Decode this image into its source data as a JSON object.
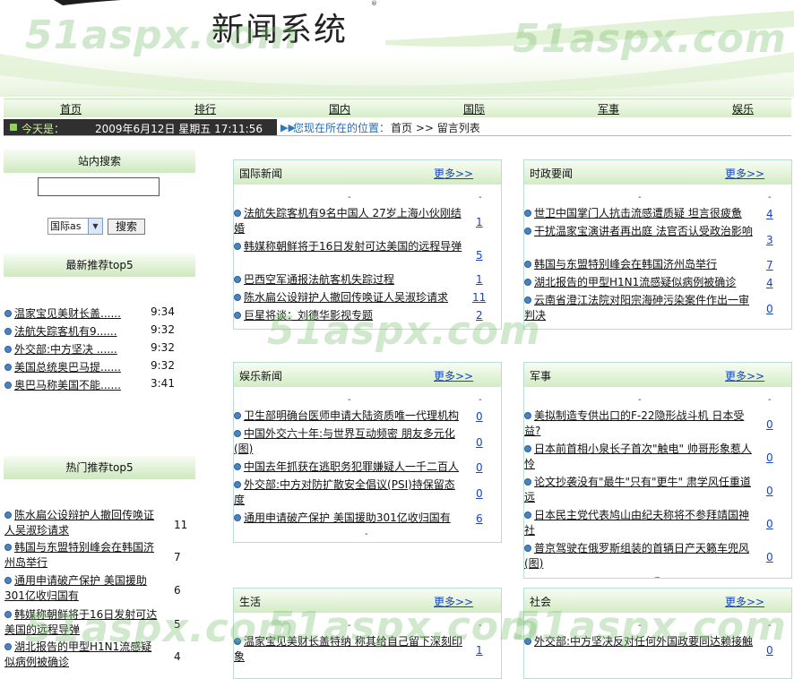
{
  "site": {
    "title": "新闻系统",
    "registered_mark": "®",
    "watermark": "51aspx.com"
  },
  "nav": {
    "items": [
      "首页",
      "排行",
      "国内",
      "国际",
      "军事",
      "娱乐"
    ]
  },
  "datebar": {
    "today_label": "今天是：",
    "date": "2009年6月12日 星期五 17:11:56",
    "location_label": "您现在所在的位置：",
    "location_path": "首页 >> 留言列表"
  },
  "search": {
    "title": "站内搜索",
    "input_value": "",
    "select_value": "国际as",
    "button_label": "搜索"
  },
  "recommend": {
    "title": "最新推荐top5",
    "items": [
      {
        "title": "温家宝见美财长盖......",
        "time": "9:34"
      },
      {
        "title": "法航失踪客机有9......",
        "time": "9:32"
      },
      {
        "title": "外交部:中方坚决 ......",
        "time": "9:32"
      },
      {
        "title": "美国总统奥巴马提......",
        "time": "9:32"
      },
      {
        "title": "奥巴马称美国不能......",
        "time": "3:41"
      }
    ]
  },
  "hot": {
    "title": "热门推荐top5",
    "items": [
      {
        "title": "陈水扁公设辩护人撤回传唤证人吴淑珍请求",
        "count": "11"
      },
      {
        "title": "韩国与东盟特别峰会在韩国济州岛举行",
        "count": "7"
      },
      {
        "title": "通用申请破产保护 美国援助301亿收归国有",
        "count": "6"
      },
      {
        "title": "韩媒称朝鲜将于16日发射可达美国的远程导弹",
        "count": "5"
      },
      {
        "title": "湖北报告的甲型H1N1流感疑似病例被确诊",
        "count": "4"
      }
    ]
  },
  "boxes": {
    "intl": {
      "title": "国际新闻",
      "more": "更多>>",
      "items": [
        {
          "title": "法航失踪客机有9名中国人 27岁上海小伙刚结婚",
          "count": "1"
        },
        {
          "title": "韩媒称朝鲜将于16日发射可达美国的远程导弹",
          "count": "5"
        },
        {
          "title": "巴西空军通报法航客机失踪过程",
          "count": "1"
        },
        {
          "title": "陈水扁公设辩护人撤回传唤证人吴淑珍请求",
          "count": "11"
        },
        {
          "title": "巨星将谈：刘德华影视专题",
          "count": "2"
        }
      ]
    },
    "politics": {
      "title": "时政要闻",
      "more": "更多>>",
      "items": [
        {
          "title": "世卫中国掌门人抗击流感遭质疑 坦言很疲惫",
          "count": "4"
        },
        {
          "title": "干扰温家宝演讲者再出庭 法官否认受政治影响",
          "count": "3"
        },
        {
          "title": "韩国与东盟特别峰会在韩国济州岛举行",
          "count": "7"
        },
        {
          "title": "湖北报告的甲型H1N1流感疑似病例被确诊",
          "count": "4"
        },
        {
          "title": "云南省澄江法院对阳宗海砷污染案件作出一审判决",
          "count": "0"
        }
      ]
    },
    "ent": {
      "title": "娱乐新闻",
      "more": "更多>>",
      "items": [
        {
          "title": "卫生部明确台医师申请大陆资质唯一代理机构",
          "count": "0"
        },
        {
          "title": "中国外交六十年:与世界互动频密 朋友多元化(图)",
          "count": "0"
        },
        {
          "title": "中国去年抓获在逃职务犯罪嫌疑人一千二百人",
          "count": "0"
        },
        {
          "title": "外交部:中方对防扩散安全倡议(PSI)持保留态度",
          "count": "0"
        },
        {
          "title": "通用申请破产保护 美国援助301亿收归国有",
          "count": "6"
        }
      ]
    },
    "mil": {
      "title": "军事",
      "more": "更多>>",
      "items": [
        {
          "title": "美拟制造专供出口的F-22隐形战斗机 日本受益?",
          "count": "0"
        },
        {
          "title": "日本前首相小泉长子首次\"触电\" 帅哥形象惹人怜",
          "count": "0"
        },
        {
          "title": "论文抄袭没有\"最牛\"只有\"更牛\" 肃学风任重道远",
          "count": "0"
        },
        {
          "title": "日本民主党代表鸠山由纪夫称将不参拜靖国神社",
          "count": "0"
        },
        {
          "title": "普京驾驶在俄罗斯组装的首辆日产天籁车兜风(图)",
          "count": "0"
        }
      ]
    },
    "life": {
      "title": "生活",
      "more": "更多>>",
      "items": [
        {
          "title": "温家宝见美财长盖特纳 称其给自己留下深刻印象",
          "count": "1"
        }
      ]
    },
    "society": {
      "title": "社会",
      "more": "更多>>",
      "items": [
        {
          "title": "外交部:中方坚决反对任何外国政要同达赖接触",
          "count": "0"
        }
      ]
    }
  },
  "colors": {
    "accent_green": "#cfe9bf",
    "link_blue": "#1a44c2",
    "date_bg": "#303030"
  }
}
